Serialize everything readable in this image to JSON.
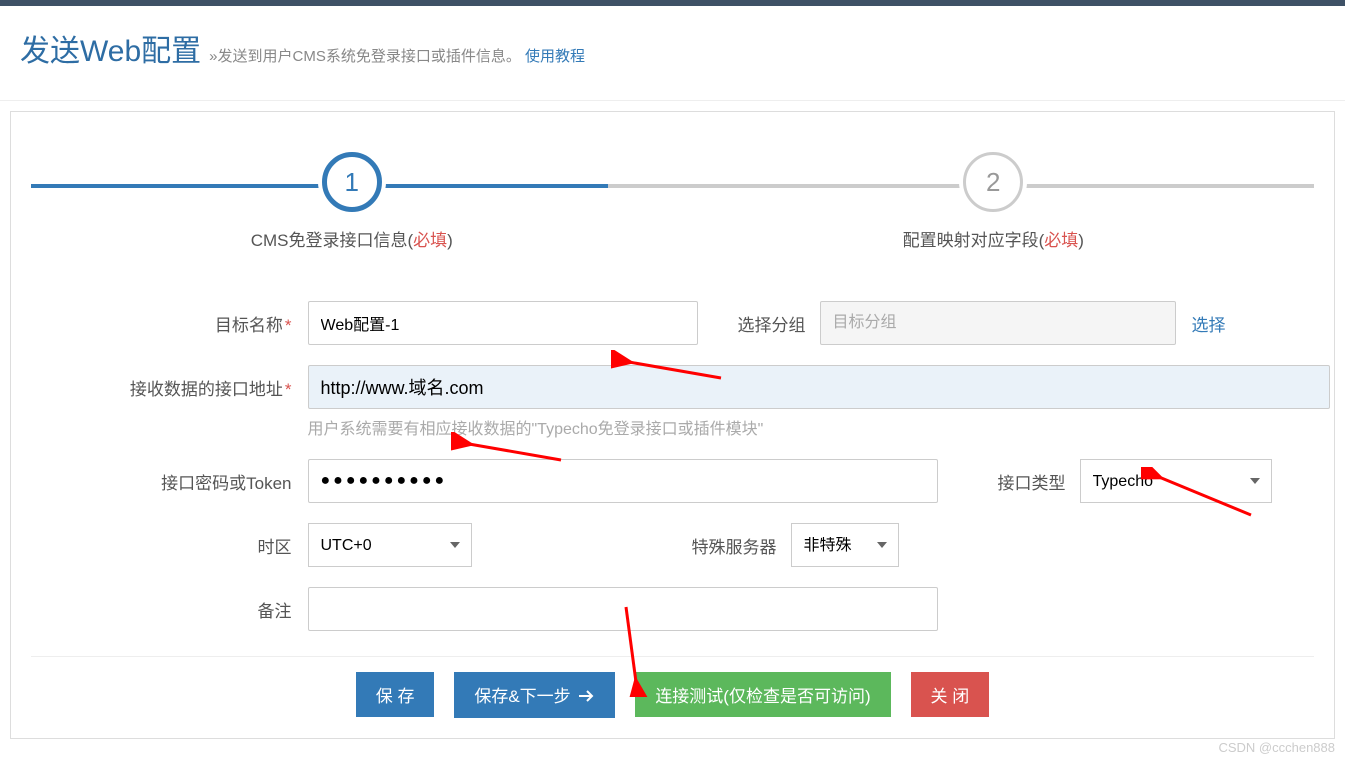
{
  "header": {
    "title": "发送Web配置",
    "subtitle_prefix": "»",
    "subtitle": "发送到用户CMS系统免登录接口或插件信息。",
    "tutorial_link": "使用教程"
  },
  "steps": {
    "step1": {
      "number": "1",
      "label_prefix": "CMS免登录接口信息(",
      "label_required": "必填",
      "label_suffix": ")"
    },
    "step2": {
      "number": "2",
      "label_prefix": "配置映射对应字段(",
      "label_required": "必填",
      "label_suffix": ")"
    }
  },
  "form": {
    "target_name": {
      "label": "目标名称",
      "value": "Web配置-1"
    },
    "select_group": {
      "label": "选择分组",
      "placeholder": "目标分组",
      "link": "选择"
    },
    "api_url": {
      "label": "接收数据的接口地址",
      "value": "http://www.域名.com",
      "help": "用户系统需要有相应接收数据的\"Typecho免登录接口或插件模块\""
    },
    "api_token": {
      "label": "接口密码或Token",
      "value": "●●●●●●●●●●"
    },
    "api_type": {
      "label": "接口类型",
      "value": "Typecho"
    },
    "timezone": {
      "label": "时区",
      "value": "UTC+0"
    },
    "special_server": {
      "label": "特殊服务器",
      "value": "非特殊"
    },
    "notes": {
      "label": "备注",
      "value": ""
    }
  },
  "buttons": {
    "save": "保 存",
    "save_next": "保存&下一步",
    "test_connection": "连接测试(仅检查是否可访问)",
    "close": "关 闭"
  },
  "watermark": "CSDN @ccchen888"
}
